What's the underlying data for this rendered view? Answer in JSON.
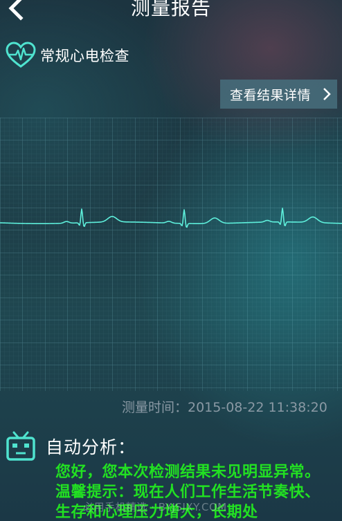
{
  "header": {
    "title": "测量报告"
  },
  "exam": {
    "title": "常规心电检查"
  },
  "details_button": {
    "label": "查看结果详情"
  },
  "measurement": {
    "time_label": "测量时间：2015-08-22 11:38:20"
  },
  "analysis": {
    "title": "自动分析：",
    "text": "您好，您本次检测结果未见明显异常。温馨提示：现在人们工作生活节奏快、生存和心理压力增大，长期处"
  },
  "watermark": "必用手机精选 · BYJSJXY.COM",
  "icons": {
    "back": "chevron-left-icon",
    "exam": "heart-pulse-icon",
    "details": "chevron-right-icon",
    "analysis": "robot-icon"
  },
  "colors": {
    "accent": "#4fe3cf",
    "analysis_text": "#22e022",
    "button_bg": "#466e7d"
  }
}
